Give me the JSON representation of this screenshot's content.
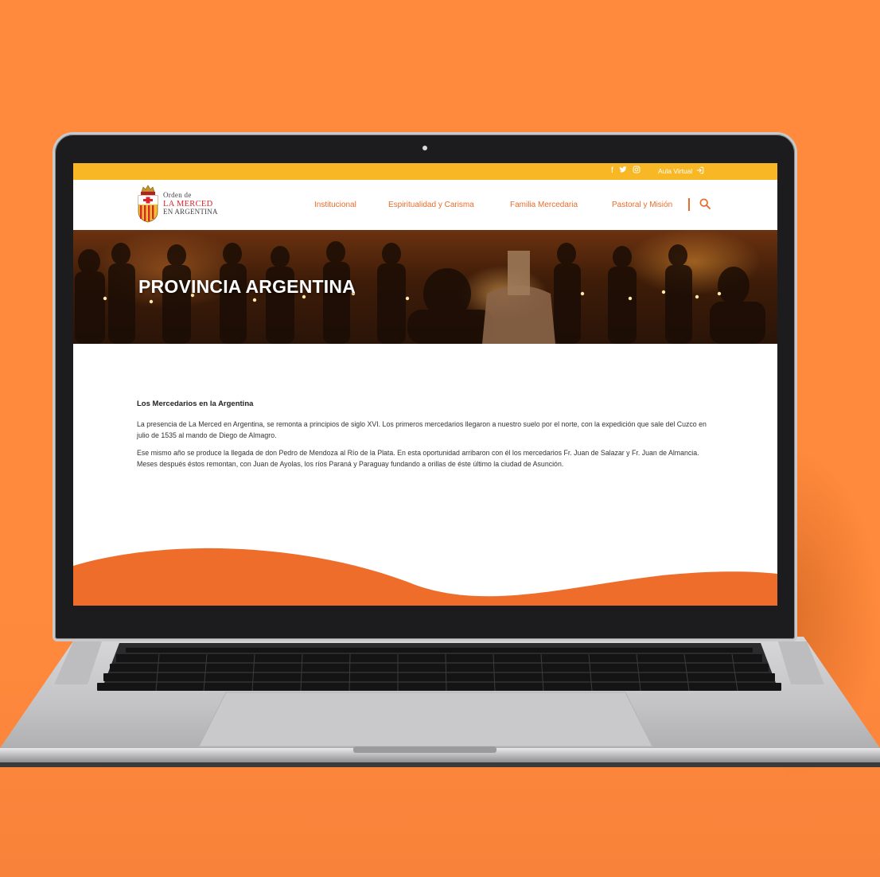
{
  "topbar": {
    "social_icons": [
      "facebook-icon",
      "twitter-icon",
      "instagram-icon"
    ],
    "aula_label": "Aula Virtual"
  },
  "logo": {
    "line1": "Orden de",
    "line2": "LA MERCED",
    "line3": "EN ARGENTINA"
  },
  "nav": {
    "items": [
      "Institucional",
      "Espiritualidad y Carisma",
      "Familia Mercedaria",
      "Pastoral y Misión"
    ]
  },
  "hero": {
    "title": "PROVINCIA ARGENTINA"
  },
  "content": {
    "heading": "Los Mercedarios en la Argentina",
    "paragraph1": "La presencia de La Merced en Argentina, se remonta a principios de siglo XVI. Los primeros mercedarios llegaron a nuestro suelo por el norte, con la expedición que sale del Cuzco en julio de 1535 al mando de Diego de Almagro.",
    "paragraph2": "Ese mismo año se produce la llegada de don Pedro de Mendoza al Río de la Plata. En esta oportunidad arribaron con él los mercedarios Fr. Juan de Salazar y Fr. Juan de Almancia. Meses después éstos remontan, con Juan de Ayolas, los ríos Paraná y Paraguay fundando a orillas de éste último la ciudad de Asunción."
  },
  "colors": {
    "background": "#ff8a3d",
    "topbar": "#f8b724",
    "accent": "#e86d2b",
    "wave": "#ee6d2a"
  }
}
